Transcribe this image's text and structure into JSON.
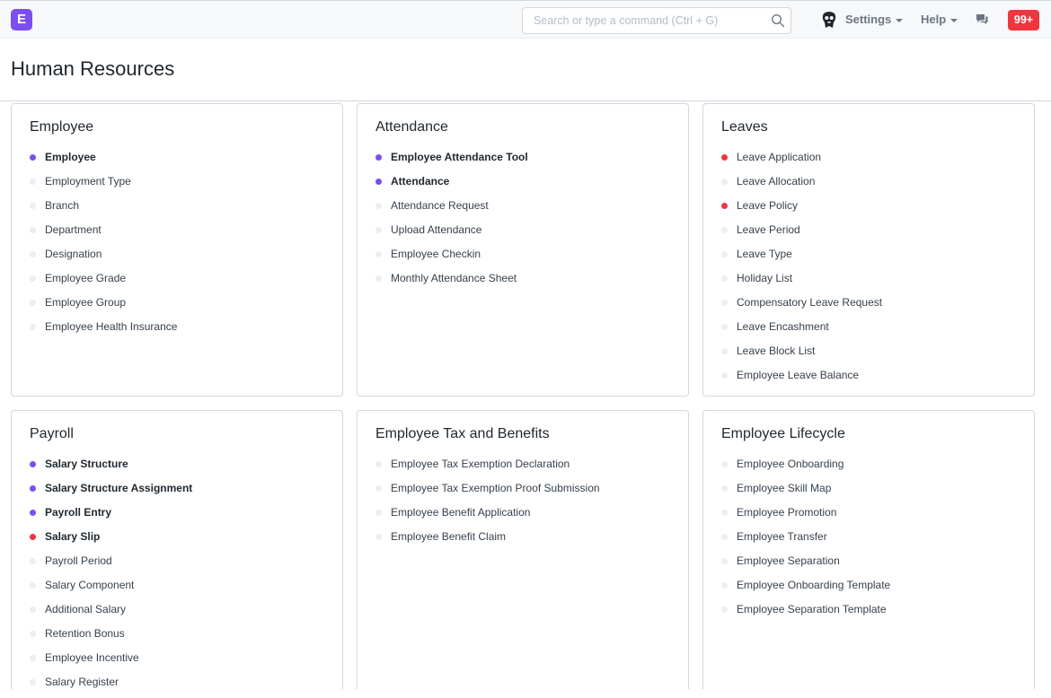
{
  "navbar": {
    "logo_letter": "E",
    "search_placeholder": "Search or type a command (Ctrl + G)",
    "settings_label": "Settings",
    "help_label": "Help",
    "notification_count": "99+"
  },
  "page": {
    "title": "Human Resources"
  },
  "colors": {
    "accent": "#7b4ff0",
    "alert": "#f0353f",
    "inactive_dot": "#ebeef2"
  },
  "cards": [
    {
      "title": "Employee",
      "items": [
        {
          "label": "Employee",
          "dot": "purple",
          "bold": true
        },
        {
          "label": "Employment Type",
          "dot": "gray",
          "bold": false
        },
        {
          "label": "Branch",
          "dot": "gray",
          "bold": false
        },
        {
          "label": "Department",
          "dot": "gray",
          "bold": false
        },
        {
          "label": "Designation",
          "dot": "gray",
          "bold": false
        },
        {
          "label": "Employee Grade",
          "dot": "gray",
          "bold": false
        },
        {
          "label": "Employee Group",
          "dot": "gray",
          "bold": false
        },
        {
          "label": "Employee Health Insurance",
          "dot": "gray",
          "bold": false
        }
      ]
    },
    {
      "title": "Attendance",
      "items": [
        {
          "label": "Employee Attendance Tool",
          "dot": "purple",
          "bold": true
        },
        {
          "label": "Attendance",
          "dot": "purple",
          "bold": true
        },
        {
          "label": "Attendance Request",
          "dot": "gray",
          "bold": false
        },
        {
          "label": "Upload Attendance",
          "dot": "gray",
          "bold": false
        },
        {
          "label": "Employee Checkin",
          "dot": "gray",
          "bold": false
        },
        {
          "label": "Monthly Attendance Sheet",
          "dot": "gray",
          "bold": false
        }
      ]
    },
    {
      "title": "Leaves",
      "items": [
        {
          "label": "Leave Application",
          "dot": "red",
          "bold": false
        },
        {
          "label": "Leave Allocation",
          "dot": "gray",
          "bold": false
        },
        {
          "label": "Leave Policy",
          "dot": "red",
          "bold": false
        },
        {
          "label": "Leave Period",
          "dot": "gray",
          "bold": false
        },
        {
          "label": "Leave Type",
          "dot": "gray",
          "bold": false
        },
        {
          "label": "Holiday List",
          "dot": "gray",
          "bold": false
        },
        {
          "label": "Compensatory Leave Request",
          "dot": "gray",
          "bold": false
        },
        {
          "label": "Leave Encashment",
          "dot": "gray",
          "bold": false
        },
        {
          "label": "Leave Block List",
          "dot": "gray",
          "bold": false
        },
        {
          "label": "Employee Leave Balance",
          "dot": "gray",
          "bold": false
        }
      ]
    },
    {
      "title": "Payroll",
      "items": [
        {
          "label": "Salary Structure",
          "dot": "purple",
          "bold": true
        },
        {
          "label": "Salary Structure Assignment",
          "dot": "purple",
          "bold": true
        },
        {
          "label": "Payroll Entry",
          "dot": "purple",
          "bold": true
        },
        {
          "label": "Salary Slip",
          "dot": "red",
          "bold": true
        },
        {
          "label": "Payroll Period",
          "dot": "gray",
          "bold": false
        },
        {
          "label": "Salary Component",
          "dot": "gray",
          "bold": false
        },
        {
          "label": "Additional Salary",
          "dot": "gray",
          "bold": false
        },
        {
          "label": "Retention Bonus",
          "dot": "gray",
          "bold": false
        },
        {
          "label": "Employee Incentive",
          "dot": "gray",
          "bold": false
        },
        {
          "label": "Salary Register",
          "dot": "gray",
          "bold": false
        }
      ]
    },
    {
      "title": "Employee Tax and Benefits",
      "items": [
        {
          "label": "Employee Tax Exemption Declaration",
          "dot": "gray",
          "bold": false
        },
        {
          "label": "Employee Tax Exemption Proof Submission",
          "dot": "gray",
          "bold": false
        },
        {
          "label": "Employee Benefit Application",
          "dot": "gray",
          "bold": false
        },
        {
          "label": "Employee Benefit Claim",
          "dot": "gray",
          "bold": false
        }
      ]
    },
    {
      "title": "Employee Lifecycle",
      "items": [
        {
          "label": "Employee Onboarding",
          "dot": "gray",
          "bold": false
        },
        {
          "label": "Employee Skill Map",
          "dot": "gray",
          "bold": false
        },
        {
          "label": "Employee Promotion",
          "dot": "gray",
          "bold": false
        },
        {
          "label": "Employee Transfer",
          "dot": "gray",
          "bold": false
        },
        {
          "label": "Employee Separation",
          "dot": "gray",
          "bold": false
        },
        {
          "label": "Employee Onboarding Template",
          "dot": "gray",
          "bold": false
        },
        {
          "label": "Employee Separation Template",
          "dot": "gray",
          "bold": false
        }
      ]
    }
  ]
}
